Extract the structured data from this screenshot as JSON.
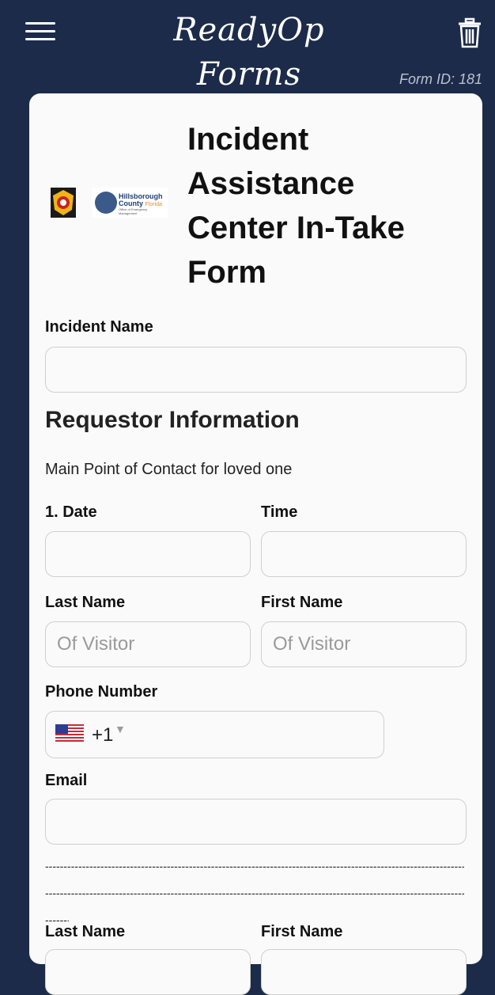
{
  "header": {
    "app_title": "ReadyOp Forms",
    "form_id": "Form ID: 181"
  },
  "form": {
    "title": "Incident Assistance Center In-Take Form",
    "incident_name_label": "Incident Name",
    "requestor_section": "Requestor Information",
    "requestor_desc": "Main Point of Contact for loved one",
    "date_label": "1. Date",
    "time_label": "Time",
    "last_name_label": "Last Name",
    "first_name_label": "First Name",
    "last_name_placeholder": "Of Visitor",
    "first_name_placeholder": "Of Visitor",
    "phone_label": "Phone Number",
    "phone_country_code": "+1",
    "email_label": "Email",
    "divider_text": "--------------------------------------------------------------------------------------------------------------------------------------------------------------------------------------------------------",
    "last_name_label_2": "Last Name",
    "first_name_label_2": "First Name"
  },
  "logos": {
    "county_name_line1": "Hillsborough",
    "county_name_line2": "County",
    "county_state": "Florida",
    "county_office": "Office of Emergency Management"
  },
  "colors": {
    "background": "#1c2b4a",
    "card": "#fafafa",
    "accent": "#1f3f73"
  },
  "icons": [
    "menu-icon",
    "trash-icon",
    "us-flag-icon",
    "caret-down-icon"
  ]
}
